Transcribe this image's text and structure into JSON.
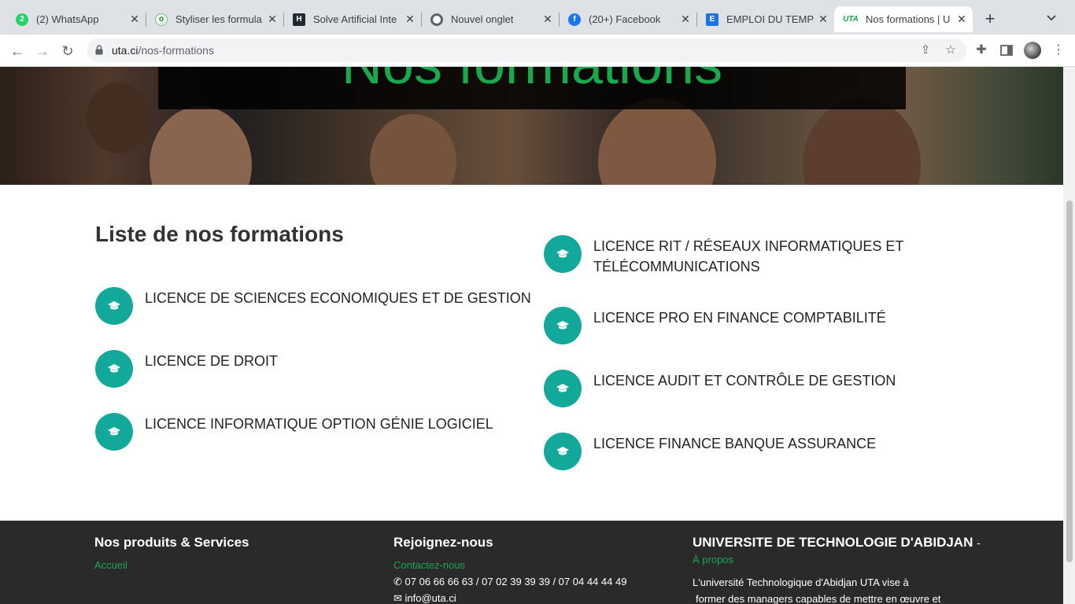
{
  "browser": {
    "tabs": [
      {
        "title": "(2) WhatsApp",
        "icon": "whatsapp-icon",
        "color": "#25d366"
      },
      {
        "title": "Styliser les formula",
        "icon": "openclassrooms-icon",
        "color": "#7451eb"
      },
      {
        "title": "Solve Artificial Inte",
        "icon": "hackerrank-icon",
        "color": "#1f2933"
      },
      {
        "title": "Nouvel onglet",
        "icon": "chrome-icon",
        "color": "#5f6368"
      },
      {
        "title": "(20+) Facebook",
        "icon": "facebook-icon",
        "color": "#1877f2"
      },
      {
        "title": "EMPLOI DU TEMPS",
        "icon": "docs-icon",
        "color": "#1a73e8"
      },
      {
        "title": "Nos formations | U",
        "icon": "uta-icon",
        "color": "#19a84c"
      }
    ],
    "address": {
      "domain": "uta.ci",
      "path": "/nos-formations"
    }
  },
  "hero": {
    "title": "Nos formations"
  },
  "content": {
    "list_title": "Liste de nos formations",
    "courses_left": [
      "LICENCE DE SCIENCES ECONOMIQUES ET DE GESTION",
      "LICENCE DE DROIT",
      "LICENCE INFORMATIQUE OPTION GÉNIE LOGICIEL"
    ],
    "courses_right": [
      "LICENCE RIT / RÉSEAUX INFORMATIQUES ET TÉLÉCOMMUNICATIONS",
      "LICENCE PRO EN FINANCE COMPTABILITÉ",
      "LICENCE AUDIT ET CONTRÔLE DE GESTION",
      "LICENCE FINANCE BANQUE ASSURANCE"
    ]
  },
  "footer": {
    "col1": {
      "title": "Nos produits & Services",
      "link": "Accueil"
    },
    "col2": {
      "title": "Rejoignez-nous",
      "link": "Contactez-nous",
      "phone": "07 06 66 66 63 / 07 02 39 39 39 / 07 04 44 44 49",
      "email": "info@uta.ci"
    },
    "col3": {
      "title": "UNIVERSITE DE TECHNOLOGIE D'ABIDJAN",
      "title_suffix": "-",
      "link": "À propos",
      "line1": "L'université Technologique d'Abidjan UTA vise à",
      "line2": "former des managers capables de mettre en œuvre  et"
    }
  },
  "colors": {
    "accent": "#19a84c",
    "icon_circle": "#12a89a",
    "footer_bg": "#2a2a2a"
  }
}
